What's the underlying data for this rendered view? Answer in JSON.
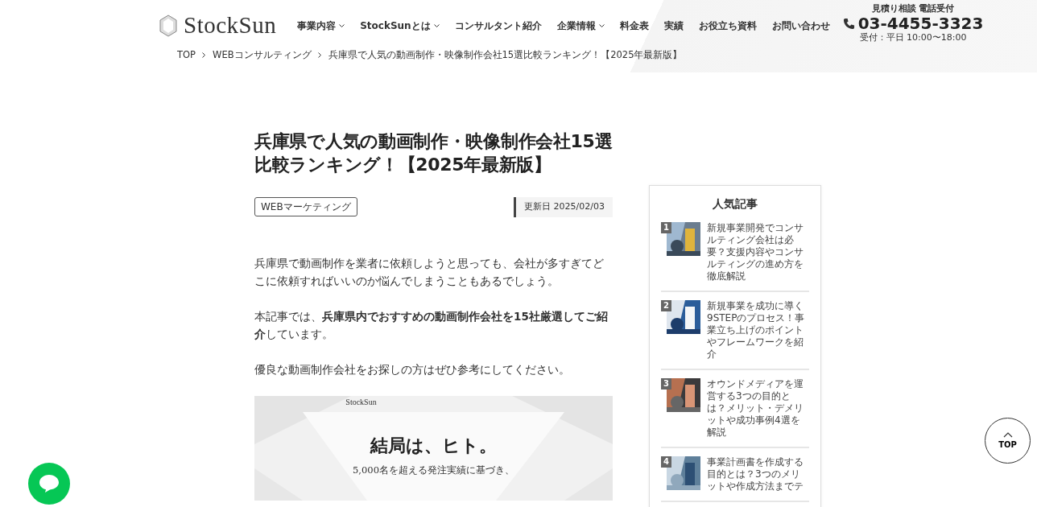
{
  "header": {
    "logo": "StockSun",
    "nav": [
      {
        "label": "事業内容",
        "dropdown": true
      },
      {
        "label": "StockSunとは",
        "dropdown": true
      },
      {
        "label": "コンサルタント紹介",
        "dropdown": false
      },
      {
        "label": "企業情報",
        "dropdown": true
      },
      {
        "label": "料金表",
        "dropdown": false
      },
      {
        "label": "実績",
        "dropdown": false
      },
      {
        "label": "お役立ち資料",
        "dropdown": false
      },
      {
        "label": "お問い合わせ",
        "dropdown": false
      }
    ],
    "contact": {
      "caption": "見積り相談 電話受付",
      "phone": "03-4455-3323",
      "hours": "受付：平日 10:00〜18:00"
    }
  },
  "breadcrumb": [
    "TOP",
    "WEBコンサルティング",
    "兵庫県で人気の動画制作・映像制作会社15選比較ランキング！【2025年最新版】"
  ],
  "article": {
    "title": "兵庫県で人気の動画制作・映像制作会社15選比較ランキング！【2025年最新版】",
    "category": "WEBマーケティング",
    "updated": "更新日 2025/02/03",
    "paragraphs": [
      "兵庫県で動画制作を業者に依頼しようと思っても、会社が多すぎてどこに依頼すればいいのか悩んでしまうこともあるでしょう。",
      "本記事では、**兵庫県内でおすすめの動画制作会社を15社厳選してご紹介**しています。",
      "優良な動画制作会社をお探しの方はぜひ参考にしてください。"
    ],
    "hero": {
      "logo": "StockSun",
      "headline": "結局は、ヒト。",
      "subline": "5,000名を超える発注実績に基づき、"
    }
  },
  "sidebar": {
    "title": "人気記事",
    "articles": [
      {
        "rank": "1",
        "title": "新規事業開発でコンサルティング会社は必要？支援内容やコンサルティングの進め方を徹底解説"
      },
      {
        "rank": "2",
        "title": "新規事業を成功に導く9STEPのプロセス！事業立ち上げのポイントやフレームワークを紹介"
      },
      {
        "rank": "3",
        "title": "オウンドメディアを運営する3つの目的とは？メリット・デメリットや成功事例4選を解説"
      },
      {
        "rank": "4",
        "title": "事業計画書を作成する目的とは？3つのメリットや作成方法までテ"
      }
    ]
  },
  "top_button": "TOP"
}
